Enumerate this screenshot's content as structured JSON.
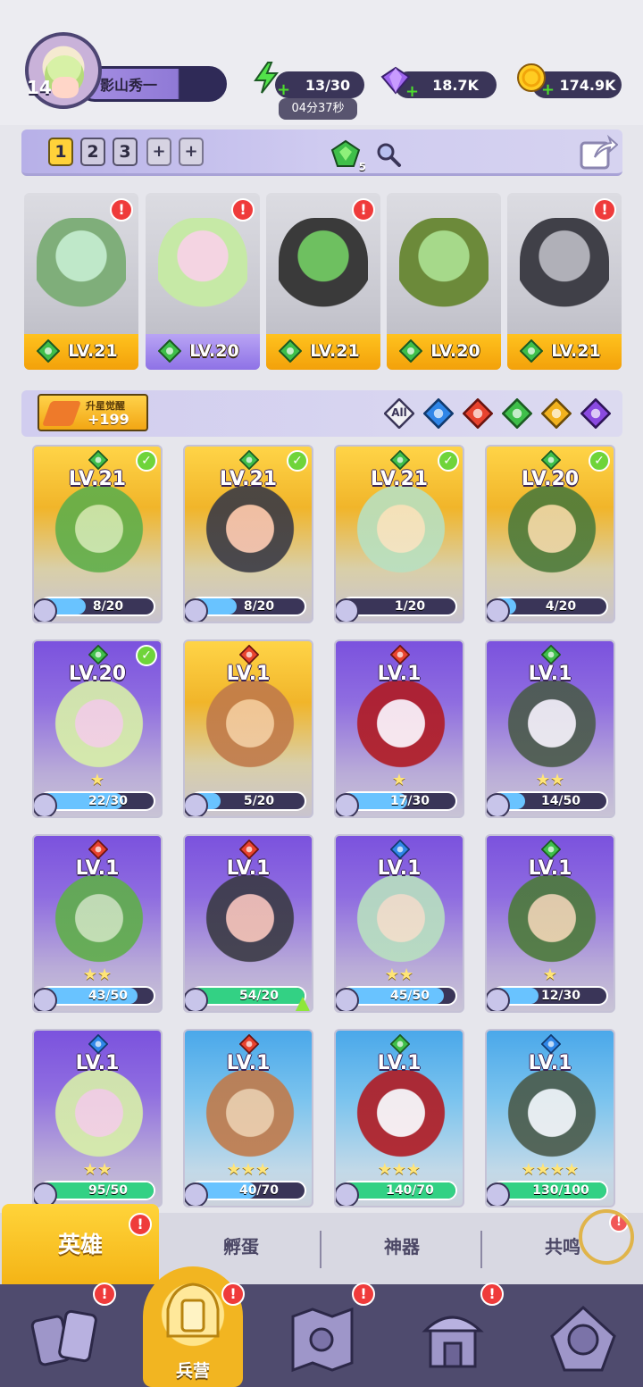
{
  "player": {
    "name": "影山秀一",
    "level": "14"
  },
  "resources": {
    "energy": "13/30",
    "energy_timer": "04分37秒",
    "gems": "18.7K",
    "coins": "174.9K"
  },
  "colors": {
    "gold": "#f4b416",
    "purple": "#8e72e6",
    "dark": "#3a3558",
    "alert": "#ef3b3b",
    "nature": "#39b54a",
    "fire": "#e23b2a",
    "water": "#2e7fe0",
    "light": "#f0b21e",
    "dark_element": "#7a3bd6"
  },
  "team": {
    "tabs": [
      "1",
      "2",
      "3",
      "+",
      "+"
    ],
    "active_tab": "1",
    "gem_count": "5",
    "members": [
      {
        "level": "LV.21",
        "element": "nature",
        "selected": false,
        "alert": "!"
      },
      {
        "level": "LV.20",
        "element": "nature",
        "selected": true,
        "alert": "!"
      },
      {
        "level": "LV.21",
        "element": "nature",
        "selected": false,
        "alert": "!"
      },
      {
        "level": "LV.20",
        "element": "nature",
        "selected": false,
        "alert": ""
      },
      {
        "level": "LV.21",
        "element": "nature",
        "selected": false,
        "alert": "!"
      }
    ]
  },
  "awaken": {
    "label": "升星觉醒",
    "value": "+199"
  },
  "filters": [
    {
      "label": "All",
      "icon": "all-filter-icon"
    },
    {
      "label": "",
      "icon": "water-element-icon"
    },
    {
      "label": "",
      "icon": "fire-element-icon"
    },
    {
      "label": "",
      "icon": "nature-element-icon"
    },
    {
      "label": "",
      "icon": "light-element-icon"
    },
    {
      "label": "",
      "icon": "dark-element-icon"
    }
  ],
  "heroes": [
    {
      "level": "LV.21",
      "shards": "8/20",
      "progress": 0.4,
      "element": "nature",
      "rarity": "gold",
      "check": true,
      "stars": ""
    },
    {
      "level": "LV.21",
      "shards": "8/20",
      "progress": 0.4,
      "element": "nature",
      "rarity": "gold",
      "check": true,
      "stars": ""
    },
    {
      "level": "LV.21",
      "shards": "1/20",
      "progress": 0.05,
      "element": "nature",
      "rarity": "gold",
      "check": true,
      "stars": ""
    },
    {
      "level": "LV.20",
      "shards": "4/20",
      "progress": 0.2,
      "element": "nature",
      "rarity": "gold",
      "check": true,
      "stars": ""
    },
    {
      "level": "LV.20",
      "shards": "22/30",
      "progress": 0.73,
      "element": "nature",
      "rarity": "purple",
      "check": true,
      "stars": "★"
    },
    {
      "level": "LV.1",
      "shards": "5/20",
      "progress": 0.25,
      "element": "fire",
      "rarity": "gold",
      "check": false,
      "stars": ""
    },
    {
      "level": "LV.1",
      "shards": "17/30",
      "progress": 0.57,
      "element": "fire",
      "rarity": "purple",
      "check": false,
      "stars": "★"
    },
    {
      "level": "LV.1",
      "shards": "14/50",
      "progress": 0.28,
      "element": "nature",
      "rarity": "purple",
      "check": false,
      "stars": "★★"
    },
    {
      "level": "LV.1",
      "shards": "43/50",
      "progress": 0.86,
      "element": "fire",
      "rarity": "purple",
      "check": false,
      "stars": "★★"
    },
    {
      "level": "LV.1",
      "shards": "54/20",
      "progress": 1.0,
      "element": "fire",
      "rarity": "purple",
      "check": false,
      "stars": "",
      "upgrade": true
    },
    {
      "level": "LV.1",
      "shards": "45/50",
      "progress": 0.9,
      "element": "water",
      "rarity": "purple",
      "check": false,
      "stars": "★★"
    },
    {
      "level": "LV.1",
      "shards": "12/30",
      "progress": 0.4,
      "element": "nature",
      "rarity": "purple",
      "check": false,
      "stars": "★"
    },
    {
      "level": "LV.1",
      "shards": "95/50",
      "progress": 1.0,
      "element": "water",
      "rarity": "purple",
      "check": false,
      "stars": "★★"
    },
    {
      "level": "LV.1",
      "shards": "40/70",
      "progress": 0.57,
      "element": "fire",
      "rarity": "blue",
      "check": false,
      "stars": "★★★"
    },
    {
      "level": "LV.1",
      "shards": "140/70",
      "progress": 1.0,
      "element": "nature",
      "rarity": "blue",
      "check": false,
      "stars": "★★★"
    },
    {
      "level": "LV.1",
      "shards": "130/100",
      "progress": 1.0,
      "element": "water",
      "rarity": "blue",
      "check": false,
      "stars": "★★★★"
    }
  ],
  "bottom_tabs": {
    "heroes": "英雄",
    "hatch": "孵蛋",
    "artifact": "神器",
    "resonance": "共鸣"
  },
  "nav": {
    "home_label": "兵营",
    "alert": "!"
  }
}
